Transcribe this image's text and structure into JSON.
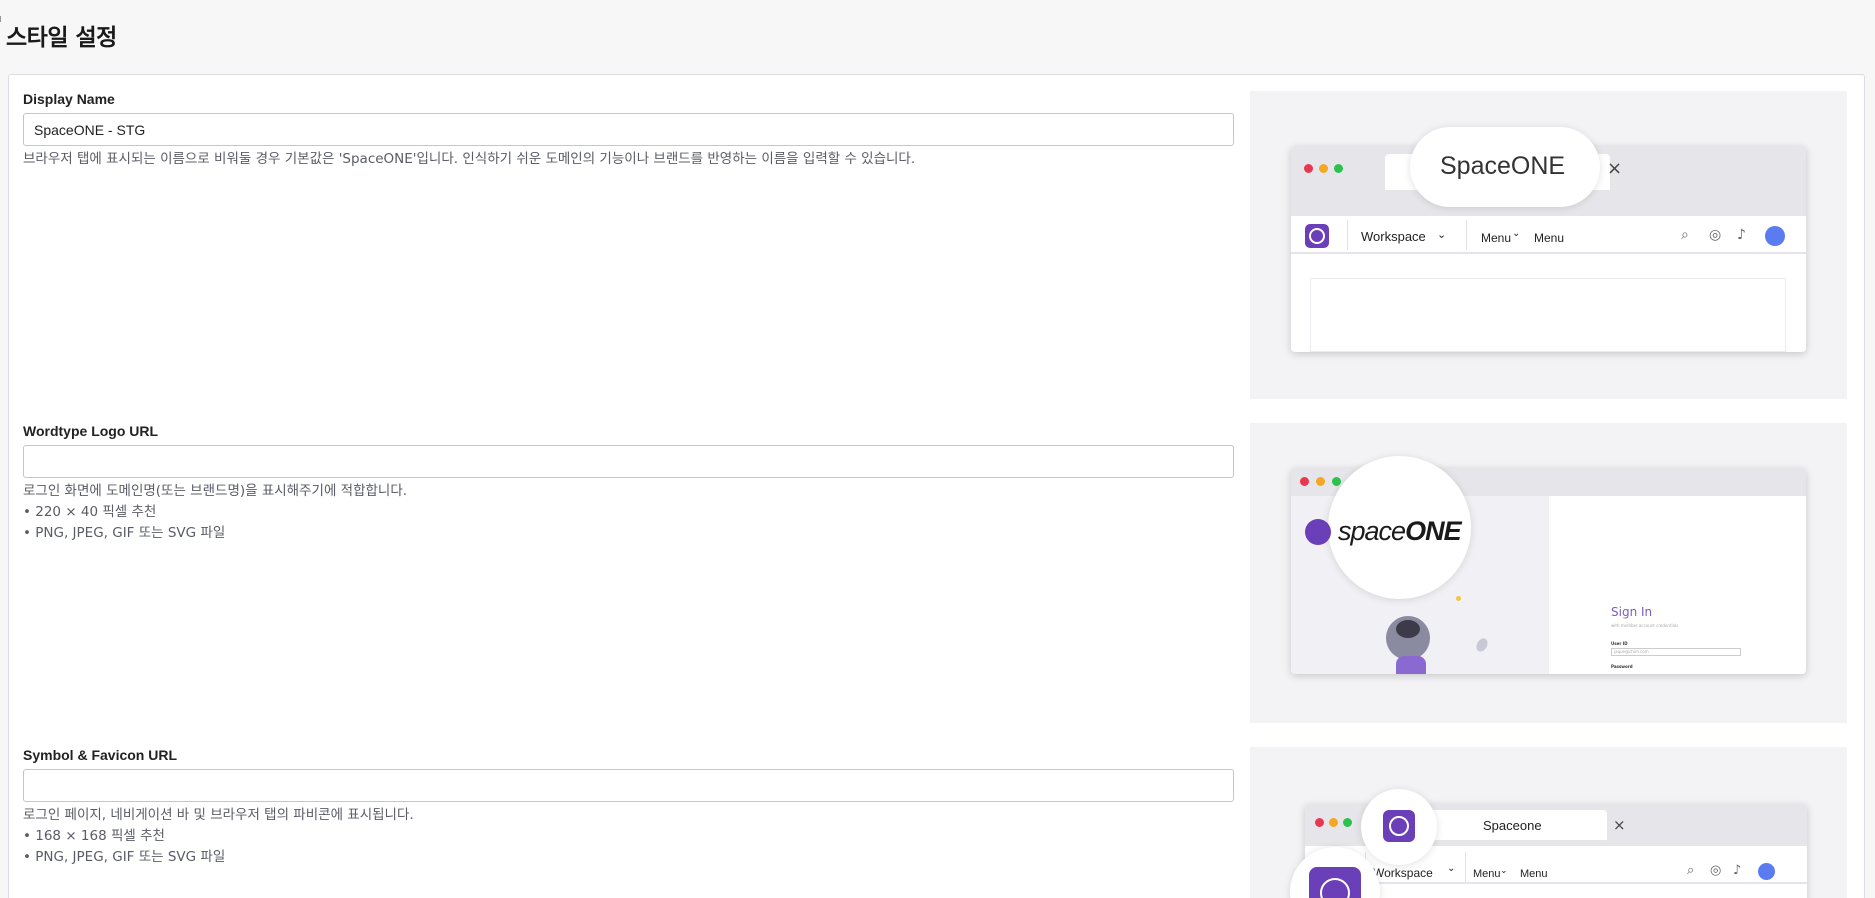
{
  "page": {
    "title": "스타일 설정"
  },
  "display_name": {
    "label": "Display Name",
    "value": "SpaceONE - STG",
    "help": "브라우저 탭에 표시되는 이름으로 비워둘 경우 기본값은 'SpaceONE'입니다. 인식하기 쉬운 도메인의 기능이나 브랜드를 반영하는 이름을 입력할 수 있습니다.",
    "preview": {
      "tab_title": "SpaceONE",
      "close": "×",
      "workspace": "Workspace",
      "menu1": "Menu",
      "menu2": "Menu"
    }
  },
  "wordtype_logo": {
    "label": "Wordtype Logo URL",
    "value": "",
    "help": [
      "로그인 화면에 도메인명(또는 브랜드명)을 표시해주기에 적합합니다.",
      "• 220 × 40 픽셀 추천",
      "• PNG, JPEG, GIF 또는 SVG 파일"
    ],
    "preview": {
      "logo_a": "space",
      "logo_b": "ONE",
      "signin": "Sign In",
      "signin_sub": "with member account credentials",
      "userid": "User ID",
      "userid_ph": "jaque@chim.com",
      "password": "Password"
    }
  },
  "symbol_favicon": {
    "label": "Symbol & Favicon URL",
    "value": "",
    "help": [
      "로그인 페이지, 네비게이션 바 및 브라우저 탭의 파비콘에 표시됩니다.",
      "• 168 × 168 픽셀 추천",
      "• PNG, JPEG, GIF 또는 SVG 파일"
    ],
    "preview": {
      "tab_title": "Spaceone",
      "close": "×",
      "workspace": "Workspace",
      "menu1": "Menu",
      "menu2": "Menu"
    }
  },
  "colors": {
    "brand": "#6b3fb7",
    "border": "#c4c6cd",
    "help_text": "#5a5c66"
  }
}
